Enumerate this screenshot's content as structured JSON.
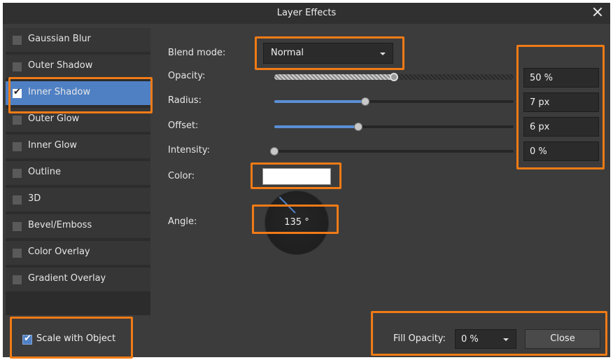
{
  "window": {
    "title": "Layer Effects"
  },
  "sidebar": {
    "items": [
      {
        "label": "Gaussian Blur",
        "checked": false
      },
      {
        "label": "Outer Shadow",
        "checked": false
      },
      {
        "label": "Inner Shadow",
        "checked": true,
        "selected": true
      },
      {
        "label": "Outer Glow",
        "checked": false
      },
      {
        "label": "Inner Glow",
        "checked": false
      },
      {
        "label": "Outline",
        "checked": false
      },
      {
        "label": "3D",
        "checked": false
      },
      {
        "label": "Bevel/Emboss",
        "checked": false
      },
      {
        "label": "Color Overlay",
        "checked": false
      },
      {
        "label": "Gradient Overlay",
        "checked": false
      }
    ]
  },
  "settings": {
    "blend_mode": {
      "label": "Blend mode:",
      "value": "Normal"
    },
    "opacity": {
      "label": "Opacity:",
      "value": "50 %",
      "level": 0.5
    },
    "radius": {
      "label": "Radius:",
      "value": "7 px",
      "level": 0.38
    },
    "offset": {
      "label": "Offset:",
      "value": "6 px",
      "level": 0.35
    },
    "intensity": {
      "label": "Intensity:",
      "value": "0 %",
      "level": 0.0
    },
    "color": {
      "label": "Color:",
      "value": "#ffffff"
    },
    "angle": {
      "label": "Angle:",
      "value": "135 °"
    }
  },
  "footer": {
    "scale_with_object": {
      "label": "Scale with Object",
      "checked": true
    },
    "fill_opacity": {
      "label": "Fill Opacity:",
      "value": "0 %"
    },
    "close_label": "Close"
  },
  "colors": {
    "accent": "#4f80c4",
    "highlight": "#f07b16",
    "panel": "#3c3c3c",
    "sidebar": "#2c2c2c"
  },
  "icons": {
    "close": "close-icon",
    "check": "check-icon",
    "dropdown": "chevron-down-icon"
  }
}
